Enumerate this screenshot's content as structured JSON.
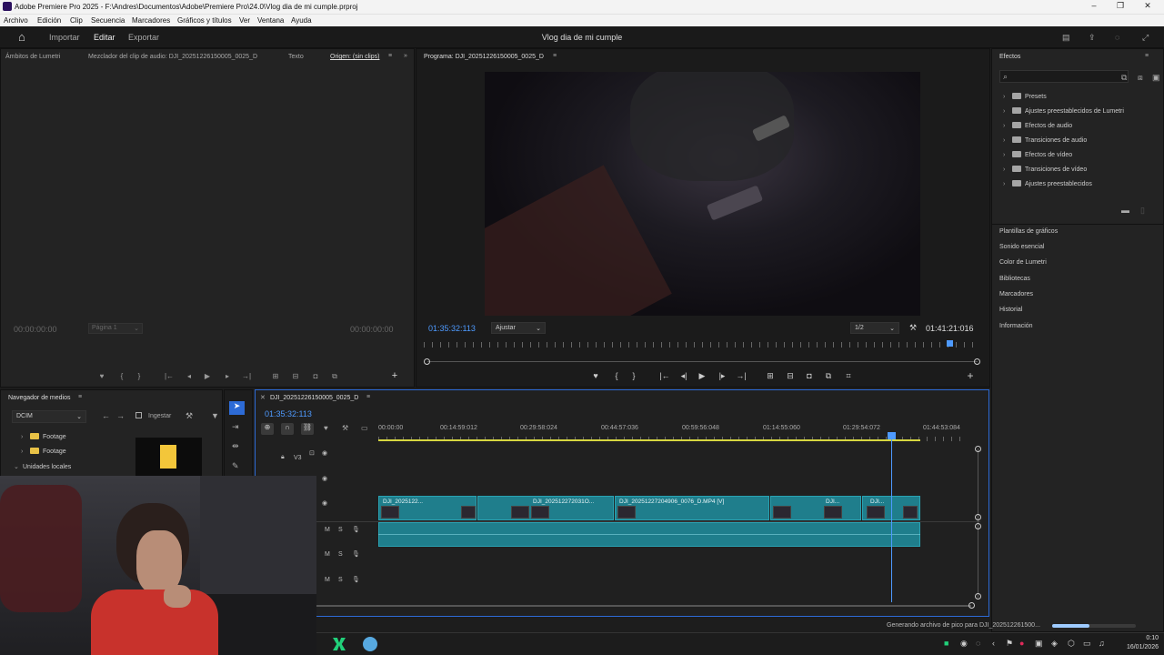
{
  "app": {
    "title": "Adobe Premiere Pro 2025 - F:\\Andres\\Documentos\\Adobe\\Premiere Pro\\24.0\\Vlog dia de mi cumple.prproj",
    "project_name": "Vlog dia de mi cumple"
  },
  "menu": [
    "Archivo",
    "Edición",
    "Clip",
    "Secuencia",
    "Marcadores",
    "Gráficos y títulos",
    "Ver",
    "Ventana",
    "Ayuda"
  ],
  "workspace": {
    "home": "⌂",
    "tabs": [
      "Importar",
      "Editar",
      "Exportar"
    ],
    "active": "Editar"
  },
  "source_panel": {
    "tabs": [
      "Ámbitos de Lumetri",
      "Mezclador del clip de audio: DJI_20251226150005_0025_D",
      "Texto",
      "Origen: (sin clips)"
    ],
    "timecode_left": "00:00:00:00",
    "page": "Página 1",
    "timecode_right": "00:00:00:00"
  },
  "program_panel": {
    "tab": "Programa: DJI_20251226150005_0025_D",
    "timecode": "01:35:32:113",
    "fit": "Ajustar",
    "resolution": "1/2",
    "duration": "01:41:21:016",
    "playhead_fraction": 0.94
  },
  "effects_panel": {
    "title": "Efectos",
    "items": [
      "Presets",
      "Ajustes preestablecidos de Lumetri",
      "Efectos de audio",
      "Transiciones de audio",
      "Efectos de vídeo",
      "Transiciones de vídeo",
      "Ajustes preestablecidos"
    ],
    "sections": [
      "Plantillas de gráficos",
      "Sonido esencial",
      "Color de Lumetri",
      "Bibliotecas",
      "Marcadores",
      "Historial",
      "Información"
    ]
  },
  "media_browser": {
    "title": "Navegador de medios",
    "location": "DCIM",
    "ingest_label": "Ingestar",
    "tree": [
      "Footage",
      "Footage",
      "Unidades locales"
    ]
  },
  "timeline": {
    "tab": "DJI_20251226150005_0025_D",
    "timecode": "01:35:32:113",
    "ruler": [
      "00:00:00",
      "00:14:59:012",
      "00:29:58:024",
      "00:44:57:036",
      "00:59:56:048",
      "01:14:55:060",
      "01:29:54:072",
      "01:44:53:084"
    ],
    "tracks": {
      "v3": "V3",
      "m": "M",
      "s": "S"
    },
    "clips": [
      {
        "label": "DJI_2025122..."
      },
      {
        "label": "DJI_202512272031O..."
      },
      {
        "label": "DJI_20251227204906_0076_D.MP4 [V]"
      },
      {
        "label": "DJI..."
      },
      {
        "label": "DJI..."
      }
    ]
  },
  "status": {
    "text": "Generando archivo de pico para DJI_202512261500...",
    "progress": 0.45
  },
  "taskbar": {
    "time": "0:10",
    "date": "16/01/2026"
  },
  "colors": {
    "accent": "#4e9aff",
    "clip": "#1f7e8c",
    "panel": "#232323"
  }
}
